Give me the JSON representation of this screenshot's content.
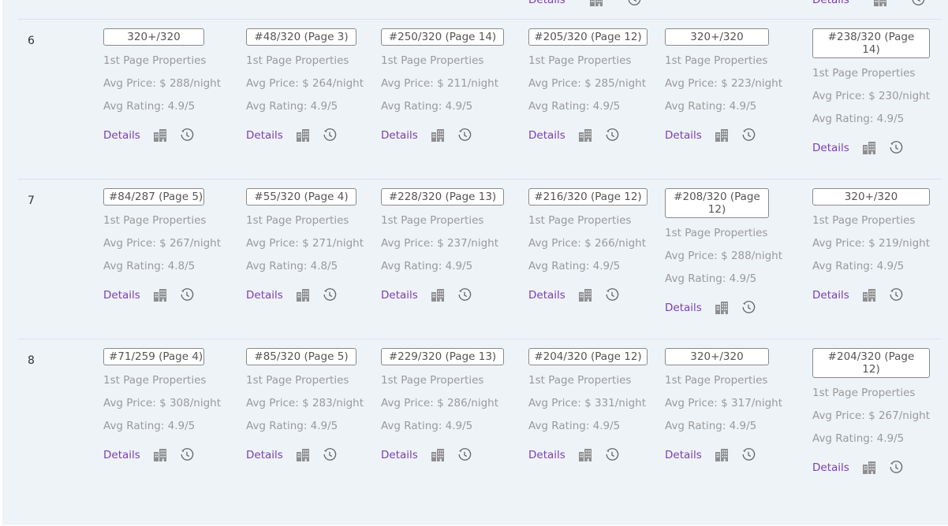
{
  "labels": {
    "properties": "1st Page Properties",
    "details": "Details"
  },
  "icons": [
    "building-icon",
    "history-clock-icon"
  ],
  "colors": {
    "link": "#7b3fb5",
    "muted": "#9a9a9a",
    "badge_border": "#8a8a8a",
    "panel_bg": "#eef3f8"
  },
  "rows": [
    {
      "number": "6",
      "cells": [
        {
          "rank": "320+/320",
          "price": "Avg Price: $ 288/night",
          "rating": "Avg Rating: 4.9/5"
        },
        {
          "rank": "#48/320 (Page 3)",
          "price": "Avg Price: $ 264/night",
          "rating": "Avg Rating: 4.9/5"
        },
        {
          "rank": "#250/320 (Page 14)",
          "price": "Avg Price: $ 211/night",
          "rating": "Avg Rating: 4.9/5"
        },
        {
          "rank": "#205/320 (Page 12)",
          "price": "Avg Price: $ 285/night",
          "rating": "Avg Rating: 4.9/5"
        },
        {
          "rank": "320+/320",
          "price": "Avg Price: $ 223/night",
          "rating": "Avg Rating: 4.9/5"
        },
        {
          "rank": "#238/320 (Page 14)",
          "price": "Avg Price: $ 230/night",
          "rating": "Avg Rating: 4.9/5"
        }
      ]
    },
    {
      "number": "7",
      "cells": [
        {
          "rank": "#84/287 (Page 5)",
          "price": "Avg Price: $ 267/night",
          "rating": "Avg Rating: 4.8/5"
        },
        {
          "rank": "#55/320 (Page 4)",
          "price": "Avg Price: $ 271/night",
          "rating": "Avg Rating: 4.8/5"
        },
        {
          "rank": "#228/320 (Page 13)",
          "price": "Avg Price: $ 237/night",
          "rating": "Avg Rating: 4.9/5"
        },
        {
          "rank": "#216/320 (Page 12)",
          "price": "Avg Price: $ 266/night",
          "rating": "Avg Rating: 4.9/5"
        },
        {
          "rank": "#208/320 (Page 12)",
          "price": "Avg Price: $ 288/night",
          "rating": "Avg Rating: 4.9/5"
        },
        {
          "rank": "320+/320",
          "price": "Avg Price: $ 219/night",
          "rating": "Avg Rating: 4.9/5"
        }
      ]
    },
    {
      "number": "8",
      "cells": [
        {
          "rank": "#71/259 (Page 4)",
          "price": "Avg Price: $ 308/night",
          "rating": "Avg Rating: 4.9/5"
        },
        {
          "rank": "#85/320 (Page 5)",
          "price": "Avg Price: $ 283/night",
          "rating": "Avg Rating: 4.9/5"
        },
        {
          "rank": "#229/320 (Page 13)",
          "price": "Avg Price: $ 286/night",
          "rating": "Avg Rating: 4.9/5"
        },
        {
          "rank": "#204/320 (Page 12)",
          "price": "Avg Price: $ 331/night",
          "rating": "Avg Rating: 4.9/5"
        },
        {
          "rank": "320+/320",
          "price": "Avg Price: $ 317/night",
          "rating": "Avg Rating: 4.9/5"
        },
        {
          "rank": "#204/320 (Page 12)",
          "price": "Avg Price: $ 267/night",
          "rating": "Avg Rating: 4.9/5"
        }
      ]
    }
  ]
}
